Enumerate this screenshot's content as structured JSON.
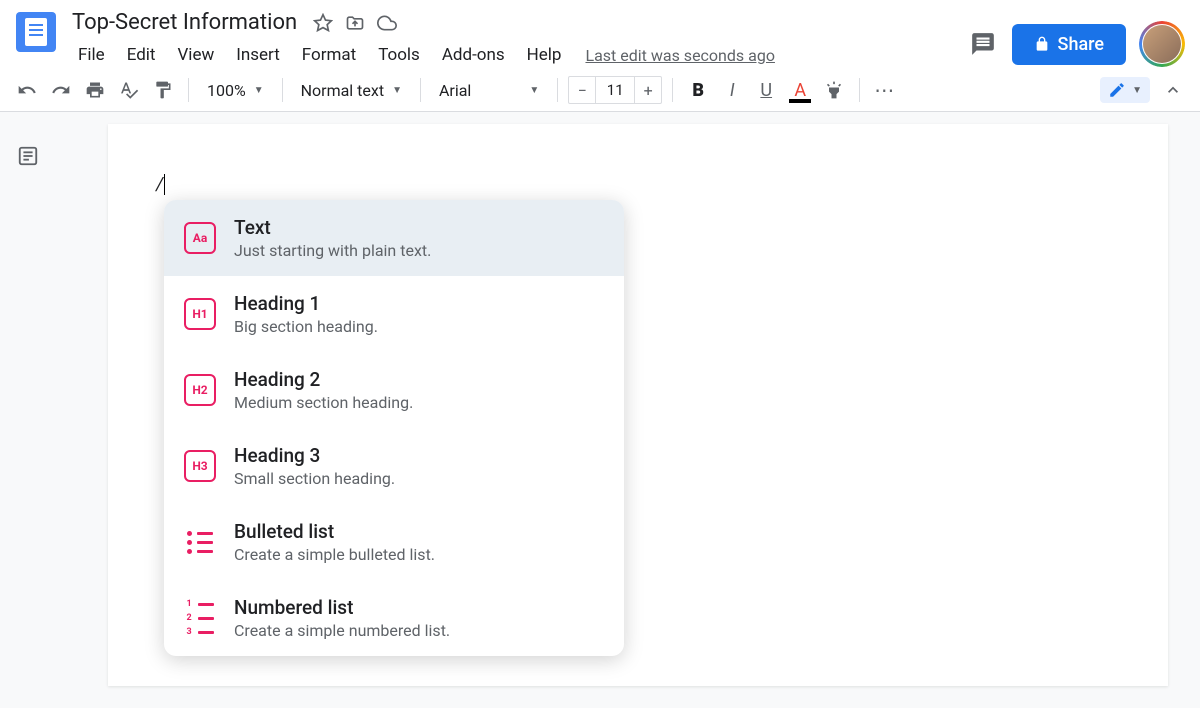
{
  "header": {
    "title": "Top-Secret Information",
    "menu": [
      "File",
      "Edit",
      "View",
      "Insert",
      "Format",
      "Tools",
      "Add-ons",
      "Help"
    ],
    "last_edit": "Last edit was seconds ago",
    "share_label": "Share"
  },
  "toolbar": {
    "zoom": "100%",
    "style": "Normal text",
    "font": "Arial",
    "font_size": "11"
  },
  "editor": {
    "typed": "/"
  },
  "slash_menu": [
    {
      "icon": "Aa",
      "title": "Text",
      "desc": "Just starting with plain text.",
      "selected": true,
      "type": "box"
    },
    {
      "icon": "H1",
      "title": "Heading 1",
      "desc": "Big section heading.",
      "selected": false,
      "type": "box"
    },
    {
      "icon": "H2",
      "title": "Heading 2",
      "desc": "Medium section heading.",
      "selected": false,
      "type": "box"
    },
    {
      "icon": "H3",
      "title": "Heading 3",
      "desc": "Small section heading.",
      "selected": false,
      "type": "box"
    },
    {
      "icon": "bullets",
      "title": "Bulleted list",
      "desc": "Create a simple bulleted list.",
      "selected": false,
      "type": "bullets"
    },
    {
      "icon": "numbers",
      "title": "Numbered list",
      "desc": "Create a simple numbered list.",
      "selected": false,
      "type": "numbers"
    }
  ]
}
